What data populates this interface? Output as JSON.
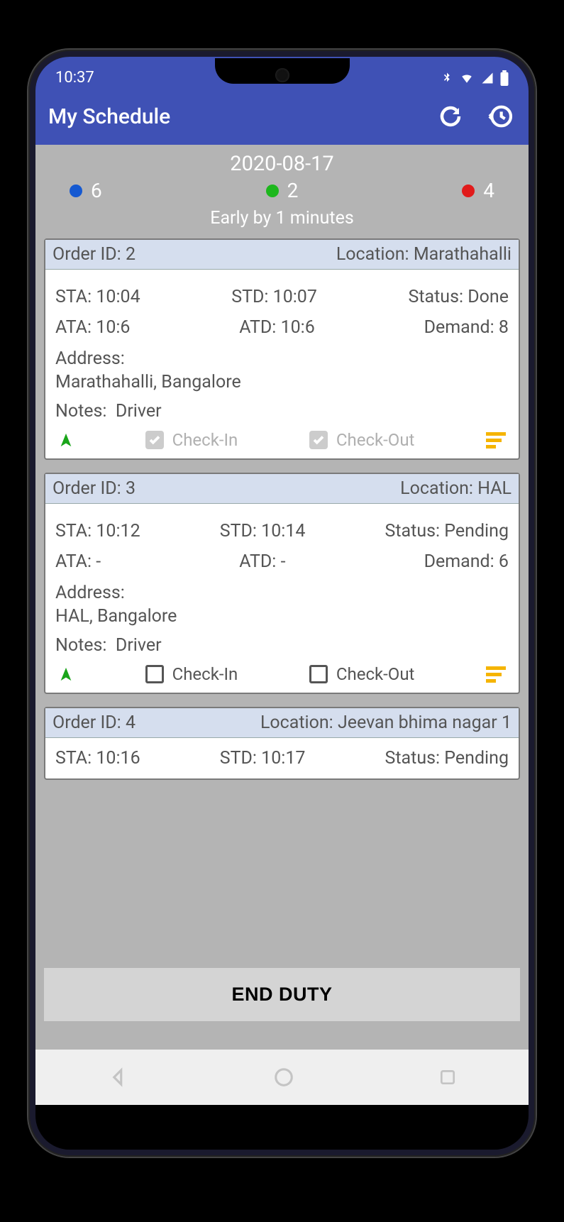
{
  "status": {
    "time": "10:37"
  },
  "appbar": {
    "title": "My Schedule"
  },
  "summary": {
    "date": "2020-08-17",
    "count_blue": "6",
    "count_green": "2",
    "count_red": "4",
    "note": "Early by 1 minutes"
  },
  "labels": {
    "order_id": "Order ID:",
    "location": "Location:",
    "sta": "STA:",
    "std": "STD:",
    "status": "Status:",
    "ata": "ATA:",
    "atd": "ATD:",
    "demand": "Demand:",
    "address": "Address:",
    "notes": "Notes:",
    "check_in": "Check-In",
    "check_out": "Check-Out"
  },
  "orders": [
    {
      "id": "2",
      "location": "Marathahalli",
      "sta": "10:04",
      "std": "10:07",
      "status": "Done",
      "ata": "10:6",
      "atd": "10:6",
      "demand": "8",
      "address": "Marathahalli, Bangalore",
      "notes": "Driver",
      "checked_in": true,
      "checked_out": true
    },
    {
      "id": "3",
      "location": "HAL",
      "sta": "10:12",
      "std": "10:14",
      "status": "Pending",
      "ata": "-",
      "atd": "-",
      "demand": "6",
      "address": "HAL, Bangalore",
      "notes": "Driver",
      "checked_in": false,
      "checked_out": false
    },
    {
      "id": "4",
      "location": "Jeevan bhima nagar 1",
      "sta": "10:16",
      "std": "10:17",
      "status": "Pending"
    }
  ],
  "end_duty": "END DUTY"
}
